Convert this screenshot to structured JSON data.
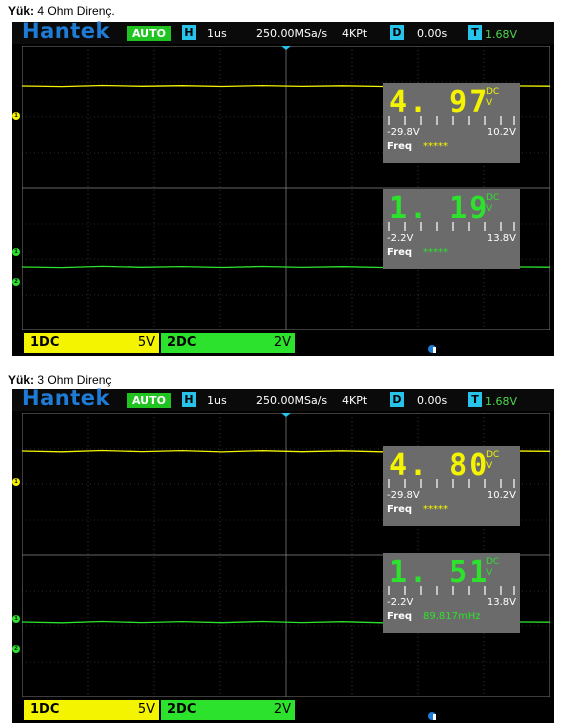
{
  "panels": [
    {
      "caption_bold": "Yük:",
      "caption_text": " 4 Ohm Direnç.",
      "topbar": {
        "brand": "Hantek",
        "mode": "AUTO",
        "h_label": "H",
        "timebase": "1us",
        "sample_rate": "250.00MSa/s",
        "memory": "4KPt",
        "d_label": "D",
        "delay": "0.00s",
        "t_label": "T",
        "trigger_level": "1.68V"
      },
      "ch1_meas": {
        "value": "4. 97",
        "coupling": "DC",
        "unit": "V",
        "min": "-29.8V",
        "max": "10.2V",
        "freq_label": "Freq",
        "freq_value": "*****"
      },
      "ch2_meas": {
        "value": "1. 19",
        "coupling": "DC",
        "unit": "V",
        "min": "-2.2V",
        "max": "13.8V",
        "freq_label": "Freq",
        "freq_value": "*****"
      },
      "bottom": {
        "ch1_label": "1DC",
        "ch1_scale": "5V",
        "ch2_label": "2DC",
        "ch2_scale": "2V"
      }
    },
    {
      "caption_bold": "Yük:",
      "caption_text": " 3 Ohm Direnç",
      "topbar": {
        "brand": "Hantek",
        "mode": "AUTO",
        "h_label": "H",
        "timebase": "1us",
        "sample_rate": "250.00MSa/s",
        "memory": "4KPt",
        "d_label": "D",
        "delay": "0.00s",
        "t_label": "T",
        "trigger_level": "1.68V"
      },
      "ch1_meas": {
        "value": "4. 80",
        "coupling": "DC",
        "unit": "V",
        "min": "-29.8V",
        "max": "10.2V",
        "freq_label": "Freq",
        "freq_value": "*****"
      },
      "ch2_meas": {
        "value": "1. 51",
        "coupling": "DC",
        "unit": "V",
        "min": "-2.2V",
        "max": "13.8V",
        "freq_label": "Freq",
        "freq_value": "89.817mHz"
      },
      "bottom": {
        "ch1_label": "1DC",
        "ch1_scale": "5V",
        "ch2_label": "2DC",
        "ch2_scale": "2V"
      }
    }
  ],
  "colors": {
    "ch1": "#f4f400",
    "ch2": "#2de22d",
    "brand": "#1e7bd6",
    "cyan": "#27c3ea",
    "meas_bg": "#6b6b6b"
  }
}
